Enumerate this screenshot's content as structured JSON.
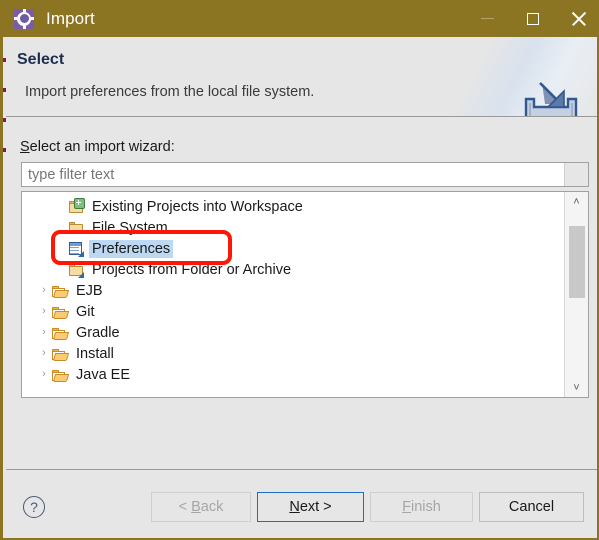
{
  "window": {
    "title": "Import",
    "title_icon": "eclipse-gear-icon",
    "accent_titlebar": "#8b7523",
    "controls": {
      "minimize": "minimize-icon",
      "maximize": "maximize-icon",
      "close": "close-icon"
    }
  },
  "banner": {
    "title": "Select",
    "description": "Import preferences from the local file system.",
    "icon": "import-arrow-into-tray-icon"
  },
  "form": {
    "label_prefix": "S",
    "label_rest": "elect an import wizard:",
    "filter": {
      "value": "",
      "placeholder": "type filter text",
      "clear_button": "clear-filter-button"
    }
  },
  "tree": {
    "items": [
      {
        "label": "Existing Projects into Workspace",
        "icon": "folder-import-icon",
        "indent": true,
        "expandable": false,
        "selected": false
      },
      {
        "label": "File System",
        "icon": "folder-icon",
        "indent": true,
        "expandable": false,
        "selected": false
      },
      {
        "label": "Preferences",
        "icon": "preferences-window-icon",
        "indent": true,
        "expandable": false,
        "selected": true
      },
      {
        "label": "Projects from Folder or Archive",
        "icon": "folder-icon",
        "indent": true,
        "expandable": false,
        "selected": false
      },
      {
        "label": "EJB",
        "icon": "folder-open-icon",
        "indent": false,
        "expandable": true,
        "selected": false
      },
      {
        "label": "Git",
        "icon": "folder-open-icon",
        "indent": false,
        "expandable": true,
        "selected": false
      },
      {
        "label": "Gradle",
        "icon": "folder-open-icon",
        "indent": false,
        "expandable": true,
        "selected": false
      },
      {
        "label": "Install",
        "icon": "folder-open-icon",
        "indent": false,
        "expandable": true,
        "selected": false
      },
      {
        "label": "Java EE",
        "icon": "folder-open-icon",
        "indent": false,
        "expandable": true,
        "selected": false
      }
    ],
    "chevron_glyph": "›",
    "scrollbar": {
      "up_glyph": "˄",
      "down_glyph": "˅"
    }
  },
  "footer": {
    "help": "?",
    "buttons": {
      "back": {
        "pre": "< ",
        "mnemonic": "B",
        "post": "ack",
        "disabled": true,
        "default": false
      },
      "next": {
        "pre": "",
        "mnemonic": "N",
        "post": "ext >",
        "disabled": false,
        "default": true
      },
      "finish": {
        "pre": "",
        "mnemonic": "F",
        "post": "inish",
        "disabled": true,
        "default": false
      },
      "cancel": {
        "pre": "",
        "mnemonic": "",
        "post": "Cancel",
        "disabled": false,
        "default": false
      }
    }
  },
  "annotation": {
    "shape": "rounded-rectangle",
    "color": "#fc1707",
    "targets": "Preferences"
  }
}
